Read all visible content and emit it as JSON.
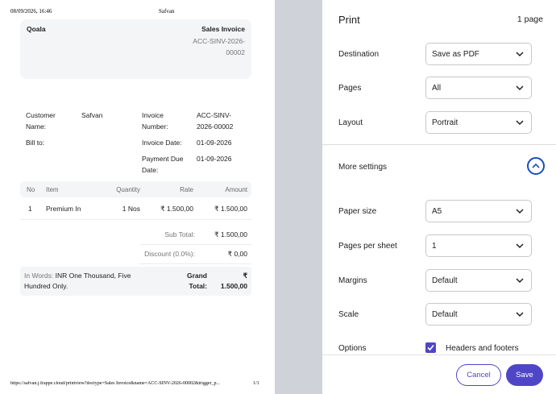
{
  "preview": {
    "header_date": "08/09/2026, 16:46",
    "header_title": "Safvan",
    "footer_url": "https://safvan.j.frappe.cloud/printview?doctype=Sales Invoice&name=ACC-SINV-2026-00002&trigger_p...",
    "footer_page": "1/1",
    "company": "Qoala",
    "doc_title": "Sales Invoice",
    "doc_number": "ACC-SINV-2026-00002",
    "customer_label": "Customer Name:",
    "customer_value": "Safvan",
    "bill_to_label": "Bill to:",
    "invoice_number_label": "Invoice Number:",
    "invoice_number_value": "ACC-SINV-2026-00002",
    "invoice_date_label": "Invoice Date:",
    "invoice_date_value": "01-09-2026",
    "due_date_label": "Payment Due Date:",
    "due_date_value": "01-09-2026",
    "columns": [
      "No",
      "Item",
      "Quantity",
      "Rate",
      "Amount"
    ],
    "rows": [
      {
        "no": "1",
        "item": "Premium In",
        "qty": "1 Nos",
        "rate": "₹ 1.500,00",
        "amount": "₹ 1.500,00"
      }
    ],
    "sub_total_label": "Sub Total:",
    "sub_total_value": "₹ 1.500,00",
    "discount_label": "Discount (0.0%):",
    "discount_value": "₹ 0,00",
    "in_words_label": "In Words:",
    "in_words_value": "INR One Thousand, Five Hundred Only.",
    "grand_total_label": "Grand Total:",
    "grand_total_value": "₹ 1.500,00"
  },
  "panel": {
    "title": "Print",
    "page_count": "1 page",
    "destination_label": "Destination",
    "destination_value": "Save as PDF",
    "pages_label": "Pages",
    "pages_value": "All",
    "layout_label": "Layout",
    "layout_value": "Portrait",
    "more_settings_label": "More settings",
    "paper_size_label": "Paper size",
    "paper_size_value": "A5",
    "pages_per_sheet_label": "Pages per sheet",
    "pages_per_sheet_value": "1",
    "margins_label": "Margins",
    "margins_value": "Default",
    "scale_label": "Scale",
    "scale_value": "Default",
    "options_label": "Options",
    "headers_footers_label": "Headers and footers",
    "headers_footers_checked": true,
    "cancel_label": "Cancel",
    "save_label": "Save",
    "accent_color": "#4f46c7"
  }
}
